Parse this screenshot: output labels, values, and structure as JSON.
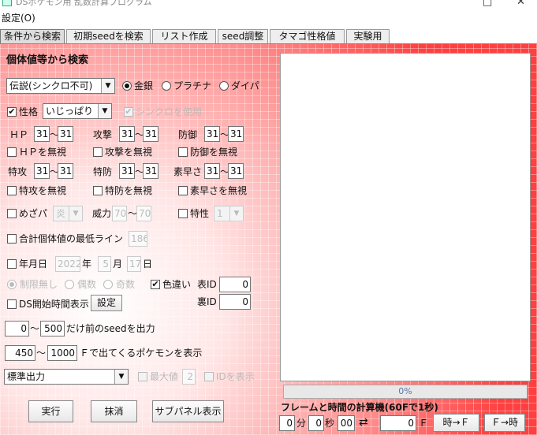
{
  "window": {
    "title": "DSポケモン用 乱数計算プログラム"
  },
  "menu": {
    "settings": "設定(O)"
  },
  "tabs": [
    "条件から検索",
    "初期seedを検索",
    "リスト作成",
    "seed調整",
    "タマゴ性格値",
    "実験用"
  ],
  "search": {
    "heading": "個体値等から検索",
    "pokemon_type": "伝説(シンクロ不可)",
    "versions": [
      "金銀",
      "プラチナ",
      "ダイパ"
    ],
    "selected_version": "金銀",
    "nature_label": "性格",
    "nature_checked": true,
    "nature_value": "いじっぱり",
    "synchro_label": "シンクロを使用",
    "synchro_checked": true,
    "stats": [
      {
        "label": "ＨＰ",
        "min": "31",
        "max": "31",
        "ignore": "ＨＰを無視"
      },
      {
        "label": "攻撃",
        "min": "31",
        "max": "31",
        "ignore": "攻撃を無視"
      },
      {
        "label": "防御",
        "min": "31",
        "max": "31",
        "ignore": "防御を無視"
      },
      {
        "label": "特攻",
        "min": "31",
        "max": "31",
        "ignore": "特攻を無視"
      },
      {
        "label": "特防",
        "min": "31",
        "max": "31",
        "ignore": "特防を無視"
      },
      {
        "label": "素早さ",
        "min": "31",
        "max": "31",
        "ignore": "素早さを無視"
      }
    ],
    "range_sep": "〜",
    "hp_type_label": "めざパ",
    "hp_type_value": "炎",
    "power_label": "威力",
    "power_min": "70",
    "power_max": "70",
    "ability_label": "特性",
    "ability_value": "1",
    "min_total_label": "合計個体値の最低ライン",
    "min_total_value": "186",
    "date_label": "年月日",
    "year": "2022",
    "year_unit": "年",
    "month": "5",
    "month_unit": "月",
    "day": "17",
    "day_unit": "日",
    "parity_options": [
      "制限無し",
      "偶数",
      "奇数"
    ],
    "shiny_label": "色違い",
    "shiny_checked": true,
    "tid_label": "表ID",
    "tid_value": "0",
    "sid_label": "裏ID",
    "sid_value": "0",
    "ds_time_label": "DS開始時間表示",
    "ds_time_button": "設定",
    "seed_min": "0",
    "seed_max": "500",
    "seed_suffix": "だけ前のseedを出力",
    "frame_min": "450",
    "frame_max": "1000",
    "frame_suffix": "Ｆで出てくるポケモンを表示",
    "output_mode": "標準出力",
    "max_label": "最大値",
    "max_value": "2",
    "other_label": "IDを表示",
    "run_button": "実行",
    "clear_button": "抹消",
    "subpanel_button": "サブパネル表示"
  },
  "progress": {
    "text": "0%",
    "value": 0
  },
  "frame_calc": {
    "title": "フレームと時間の計算機(60Fで1秒)",
    "minutes": "0",
    "minutes_unit": "分",
    "seconds": "0",
    "seconds_unit": "秒",
    "centis": "00",
    "swap_icon": "⇄",
    "frames": "0",
    "frames_unit": "Ｆ",
    "time_to_frame": "時→Ｆ",
    "frame_to_time": "Ｆ→時"
  }
}
